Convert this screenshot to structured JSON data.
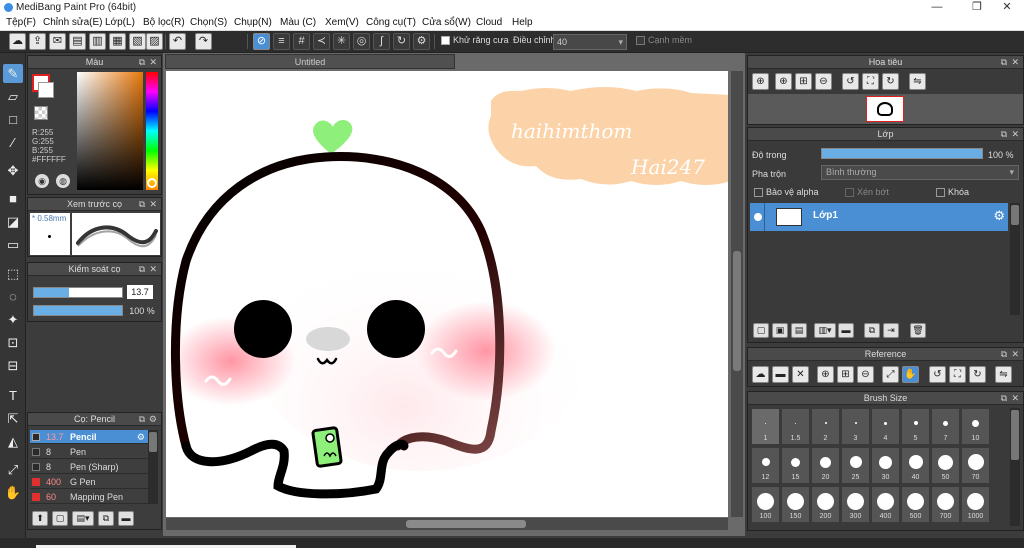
{
  "window": {
    "title": "MediBang Paint Pro (64bit)",
    "minimize": "—",
    "restore": "❐",
    "close": "✕"
  },
  "menu": [
    "Tệp(F)",
    "Chỉnh sửa(E)",
    "Lớp(L)",
    "Bộ lọc(R)",
    "Chọn(S)",
    "Chụp(N)",
    "Màu (C)",
    "Xem(V)",
    "Công cụ(T)",
    "Cửa sổ(W)",
    "Cloud",
    "Help"
  ],
  "toolbar": {
    "antialias_label": "Khử răng cưa",
    "adjust_label": "Điều chỉnh",
    "adjust_value": "40",
    "smooth_label": "Cạnh mềm"
  },
  "color_panel": {
    "title": "Màu",
    "r": "R:255",
    "g": "G:255",
    "b": "B:255",
    "hex": "#FFFFFF"
  },
  "brush_preview": {
    "title": "Xem trước cọ",
    "size": "* 0.58mm"
  },
  "brush_control": {
    "title": "Kiểm soát cọ",
    "size_value": "13.7",
    "opacity_value": "100 %",
    "size_fraction": 0.4,
    "opacity_fraction": 1.0
  },
  "brush_list": {
    "title": "Cọ: Pencil",
    "items": [
      {
        "size": "13.7",
        "name": "Pencil",
        "color": "#2a2a2a",
        "selected": true
      },
      {
        "size": "8",
        "name": "Pen",
        "color": "#2a2a2a",
        "selected": false
      },
      {
        "size": "8",
        "name": "Pen (Sharp)",
        "color": "#2a2a2a",
        "selected": false
      },
      {
        "size": "400",
        "name": "G Pen",
        "color": "#e03030",
        "selected": false
      },
      {
        "size": "60",
        "name": "Mapping Pen",
        "color": "#e03030",
        "selected": false
      }
    ]
  },
  "canvas": {
    "tab_title": "Untitled",
    "bubble_line1": "haihimthom",
    "bubble_line2": "Hai247"
  },
  "navigator": {
    "title": "Hoa tiêu"
  },
  "layers": {
    "title": "Lớp",
    "opacity_label": "Độ trong",
    "opacity_value": "100 %",
    "opacity_fraction": 1.0,
    "blend_label": "Pha trộn",
    "blend_value": "Bình thường",
    "protect_alpha": "Bảo vệ alpha",
    "clipping": "Xén bớt",
    "lock": "Khóa",
    "layer_name": "Lớp1"
  },
  "reference": {
    "title": "Reference"
  },
  "brush_size": {
    "title": "Brush Size",
    "sizes": [
      "1",
      "1.5",
      "2",
      "3",
      "4",
      "5",
      "7",
      "10",
      "12",
      "15",
      "20",
      "25",
      "30",
      "40",
      "50",
      "70",
      "100",
      "150",
      "200",
      "300",
      "400",
      "500",
      "700",
      "1000"
    ],
    "selected": "1"
  },
  "colors": {
    "accent": "#4a8fd4",
    "bubble": "#fcd3a8",
    "sprout": "#8ef07a"
  }
}
